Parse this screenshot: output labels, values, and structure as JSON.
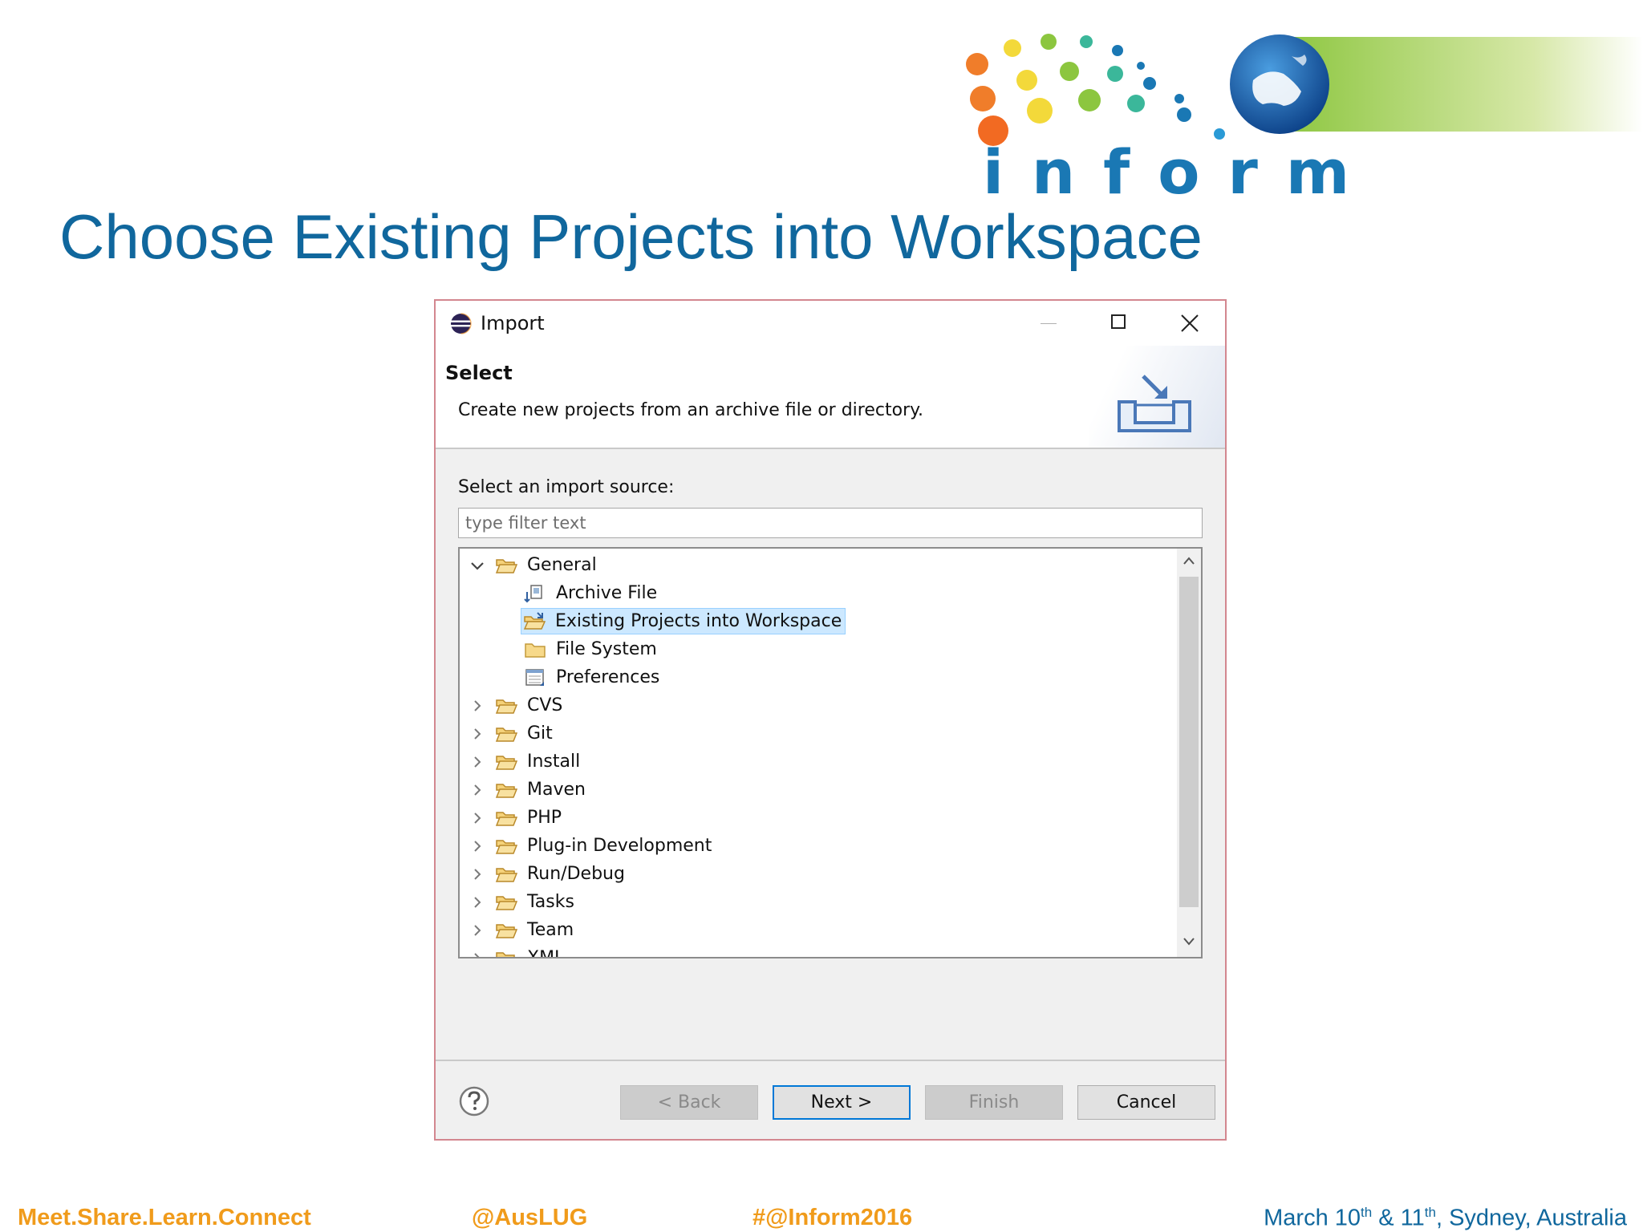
{
  "logo": {
    "wordmark": "inform"
  },
  "slide": {
    "title": "Choose Existing Projects into Workspace"
  },
  "dialog": {
    "window_title": "Import",
    "banner": {
      "title": "Select",
      "description": "Create new projects from an archive file or directory."
    },
    "source_label": "Select an import source:",
    "filter": {
      "placeholder": "type filter text",
      "value": ""
    },
    "tree": [
      {
        "label": "General",
        "expanded": true,
        "children": [
          {
            "label": "Archive File",
            "icon": "archive-file-icon"
          },
          {
            "label": "Existing Projects into Workspace",
            "icon": "existing-projects-icon",
            "selected": true
          },
          {
            "label": "File System",
            "icon": "folder-icon"
          },
          {
            "label": "Preferences",
            "icon": "preferences-icon"
          }
        ]
      },
      {
        "label": "CVS",
        "expanded": false
      },
      {
        "label": "Git",
        "expanded": false
      },
      {
        "label": "Install",
        "expanded": false
      },
      {
        "label": "Maven",
        "expanded": false
      },
      {
        "label": "PHP",
        "expanded": false
      },
      {
        "label": "Plug-in Development",
        "expanded": false
      },
      {
        "label": "Run/Debug",
        "expanded": false
      },
      {
        "label": "Tasks",
        "expanded": false
      },
      {
        "label": "Team",
        "expanded": false
      },
      {
        "label": "XML",
        "expanded": false
      }
    ],
    "buttons": {
      "back": "< Back",
      "next": "Next >",
      "finish": "Finish",
      "cancel": "Cancel"
    }
  },
  "footer": {
    "tagline": "Meet.Share.Learn.Connect",
    "handle": "@AusLUG",
    "hashtag": "#@Inform2016",
    "event_date_a": "March 10",
    "event_date_a_sup": "th",
    "event_date_b": " & 11",
    "event_date_b_sup": "th",
    "event_location": ", Sydney, Australia"
  },
  "colors": {
    "title_blue": "#10679d",
    "footer_orange": "#f09b1b",
    "selection_bg": "#cce8ff",
    "dialog_border": "#d3878f"
  }
}
